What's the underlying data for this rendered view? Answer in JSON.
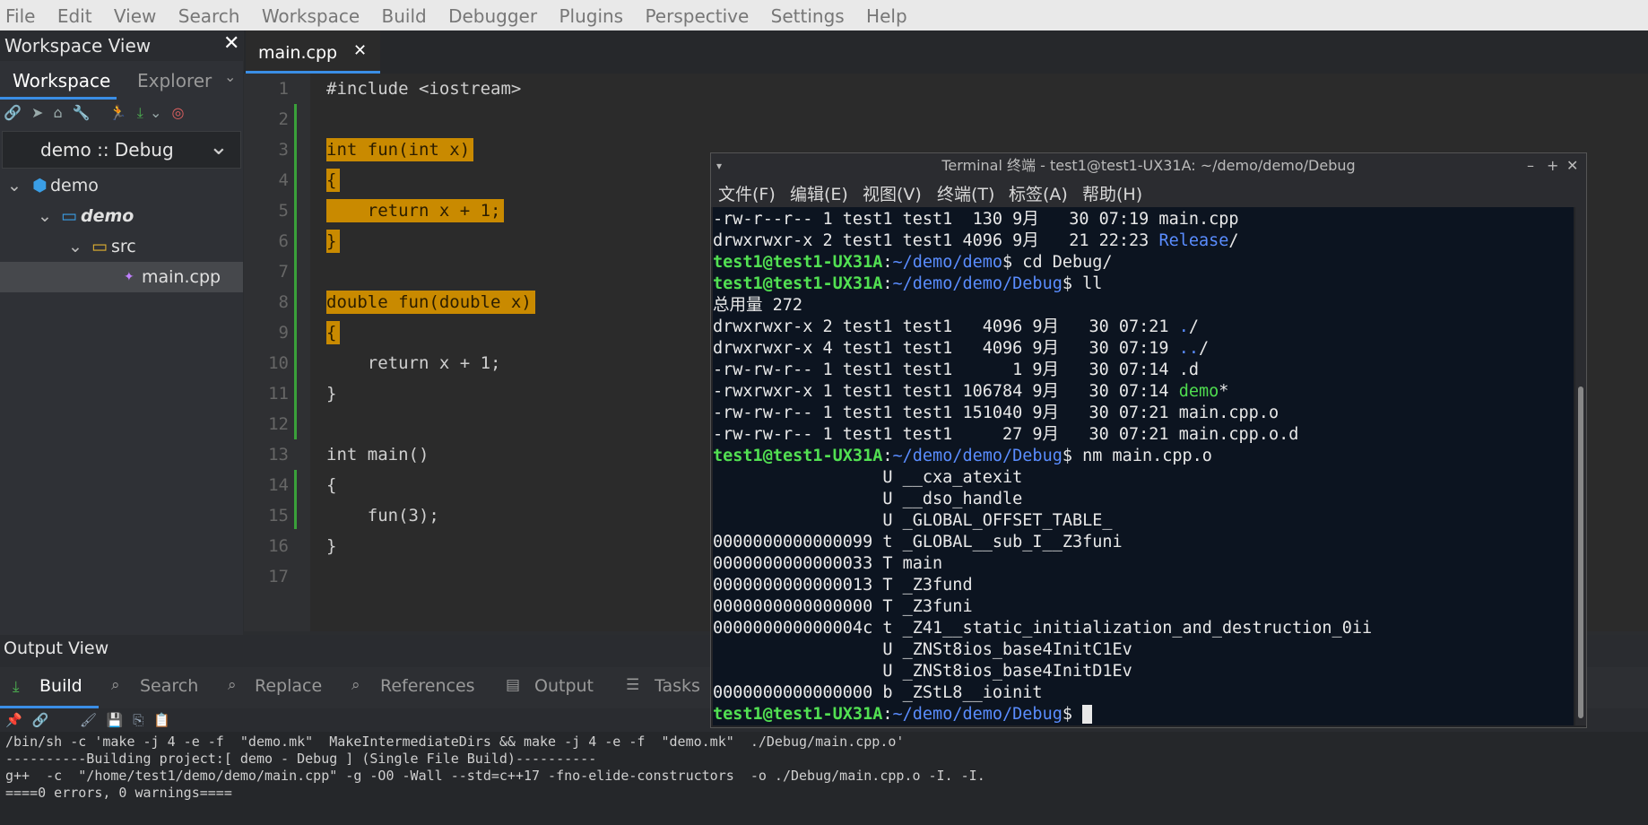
{
  "menubar": [
    "File",
    "Edit",
    "View",
    "Search",
    "Workspace",
    "Build",
    "Debugger",
    "Plugins",
    "Perspective",
    "Settings",
    "Help"
  ],
  "workspace": {
    "title": "Workspace View",
    "tabs": [
      "Workspace",
      "Explorer"
    ],
    "config": "demo :: Debug",
    "tree": [
      {
        "label": "demo",
        "level": 0,
        "kind": "workspace"
      },
      {
        "label": "demo",
        "level": 1,
        "kind": "project"
      },
      {
        "label": "src",
        "level": 2,
        "kind": "folder"
      },
      {
        "label": "main.cpp",
        "level": 3,
        "kind": "file"
      }
    ]
  },
  "editor": {
    "tab": "main.cpp",
    "lines": [
      "#include <iostream>",
      "",
      "int fun(int x)",
      "{",
      "    return x + 1;",
      "}",
      "",
      "double fun(double x)",
      "{",
      "    return x + 1;",
      "}",
      "",
      "int main()",
      "{",
      "    fun(3);",
      "}",
      ""
    ]
  },
  "output": {
    "title": "Output View",
    "tabs": [
      "Build",
      "Search",
      "Replace",
      "References",
      "Output",
      "Tasks"
    ],
    "lines": [
      "/bin/sh -c 'make -j 4 -e -f  \"demo.mk\"  MakeIntermediateDirs && make -j 4 -e -f  \"demo.mk\"  ./Debug/main.cpp.o'",
      "----------Building project:[ demo - Debug ] (Single File Build)----------",
      "g++  -c  \"/home/test1/demo/demo/main.cpp\" -g -O0 -Wall --std=c++17 -fno-elide-constructors  -o ./Debug/main.cpp.o -I. -I.",
      "====0 errors, 0 warnings===="
    ]
  },
  "terminal": {
    "title": "Terminal 终端 - test1@test1-UX31A: ~/demo/demo/Debug",
    "menu": [
      "文件(F)",
      "编辑(E)",
      "视图(V)",
      "终端(T)",
      "标签(A)",
      "帮助(H)"
    ],
    "lines": [
      {
        "t": "-rw-r--r-- 1 test1 test1  130 9月   30 07:19 main.cpp"
      },
      {
        "t": "drwxrwxr-x 2 test1 test1 4096 9月   21 22:23 ",
        "d": "Release",
        "s": "/"
      },
      {
        "p": "test1@test1-UX31A",
        "path": "~/demo/demo",
        "t": "$ cd Debug/"
      },
      {
        "p": "test1@test1-UX31A",
        "path": "~/demo/demo/Debug",
        "t": "$ ll"
      },
      {
        "t": "总用量 272"
      },
      {
        "t": "drwxrwxr-x 2 test1 test1   4096 9月   30 07:21 ",
        "d": ".",
        "s": "/"
      },
      {
        "t": "drwxrwxr-x 4 test1 test1   4096 9月   30 07:19 ",
        "d": "..",
        "s": "/"
      },
      {
        "t": "-rw-rw-r-- 1 test1 test1      1 9月   30 07:14 .d"
      },
      {
        "t": "-rwxrwxr-x 1 test1 test1 106784 9月   30 07:14 ",
        "x": "demo",
        "s": "*"
      },
      {
        "t": "-rw-rw-r-- 1 test1 test1 151040 9月   30 07:21 main.cpp.o"
      },
      {
        "t": "-rw-rw-r-- 1 test1 test1     27 9月   30 07:21 main.cpp.o.d"
      },
      {
        "p": "test1@test1-UX31A",
        "path": "~/demo/demo/Debug",
        "t": "$ nm main.cpp.o"
      },
      {
        "t": "                 U __cxa_atexit"
      },
      {
        "t": "                 U __dso_handle"
      },
      {
        "t": "                 U _GLOBAL_OFFSET_TABLE_"
      },
      {
        "t": "0000000000000099 t _GLOBAL__sub_I__Z3funi"
      },
      {
        "t": "0000000000000033 T main"
      },
      {
        "t": "0000000000000013 T _Z3fund"
      },
      {
        "t": "0000000000000000 T _Z3funi"
      },
      {
        "t": "000000000000004c t _Z41__static_initialization_and_destruction_0ii"
      },
      {
        "t": "                 U _ZNSt8ios_base4InitC1Ev"
      },
      {
        "t": "                 U _ZNSt8ios_base4InitD1Ev"
      },
      {
        "t": "0000000000000000 b _ZStL8__ioinit"
      },
      {
        "p": "test1@test1-UX31A",
        "path": "~/demo/demo/Debug",
        "t": "$ ",
        "cursor": true
      }
    ]
  }
}
